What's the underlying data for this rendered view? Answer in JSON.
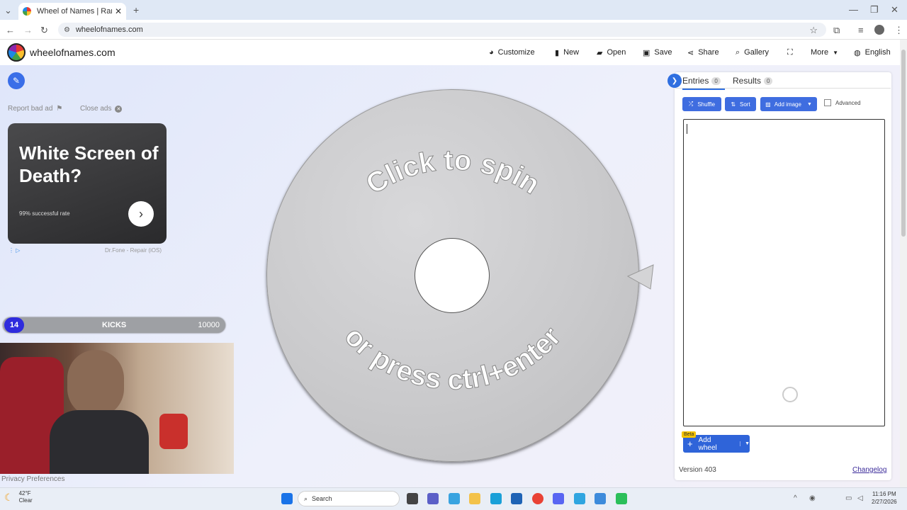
{
  "browser": {
    "tab_title": "Wheel of Names | Random nam",
    "url": "wheelofnames.com"
  },
  "site": {
    "name": "wheelofnames.com",
    "menu": [
      "Customize",
      "New",
      "Open",
      "Save",
      "Share",
      "Gallery",
      "More",
      "English"
    ]
  },
  "ad": {
    "report": "Report bad ad",
    "close": "Close ads",
    "headline": "White Screen of Death?",
    "sub": "99% successful rate",
    "source": "Dr.Fone - Repair (iOS)"
  },
  "overlay": {
    "count": "14",
    "label": "KICKS",
    "max": "10000"
  },
  "privacy": "Privacy Preferences",
  "wheel": {
    "top_text": "Click to spin",
    "bottom_text": "or press ctrl+enter"
  },
  "panel": {
    "tabs": [
      {
        "label": "Entries",
        "count": "0"
      },
      {
        "label": "Results",
        "count": "0"
      }
    ],
    "buttons": {
      "shuffle": "Shuffle",
      "sort": "Sort",
      "add_image": "Add image"
    },
    "advanced": "Advanced",
    "entries_value": "",
    "beta": "Beta",
    "add_wheel": "Add wheel",
    "version": "Version 403",
    "changelog": "Changelog"
  },
  "taskbar": {
    "temp": "42°F",
    "condition": "Clear",
    "search": "Search",
    "time": "11:16 PM",
    "date": "2/27/2026"
  },
  "colors": {
    "accent": "#3f6de0",
    "overlay_badge": "#2e2bdd",
    "add_wheel": "#2f64d9"
  }
}
